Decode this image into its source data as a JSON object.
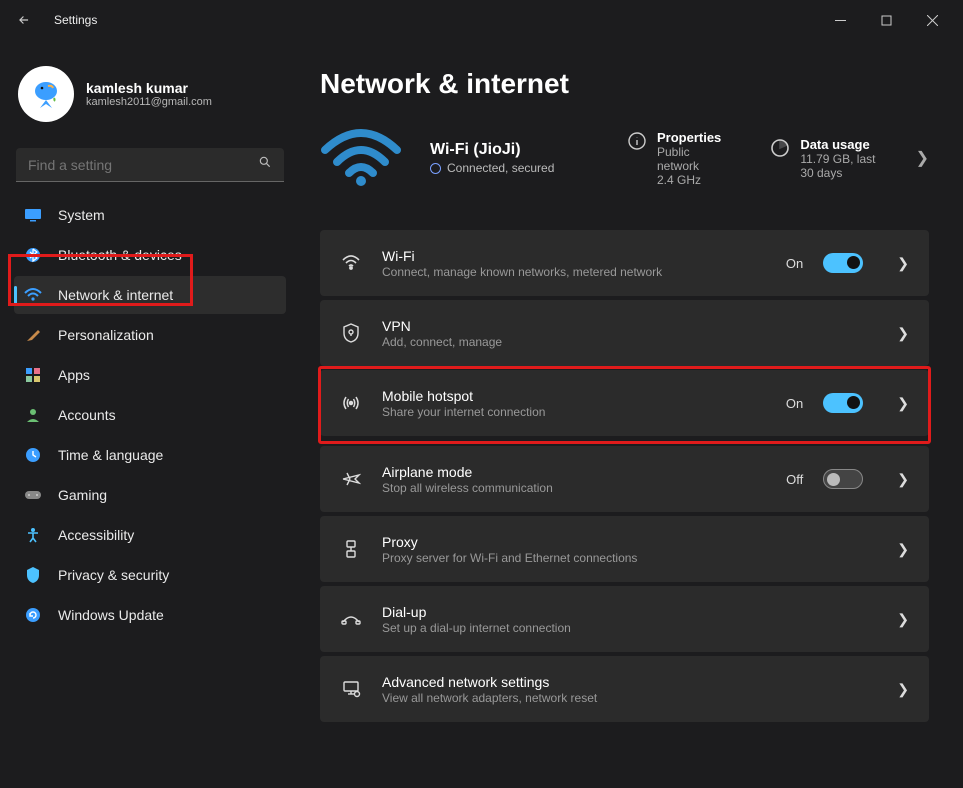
{
  "window": {
    "title": "Settings"
  },
  "user": {
    "name": "kamlesh kumar",
    "email": "kamlesh2011@gmail.com"
  },
  "search": {
    "placeholder": "Find a setting"
  },
  "nav": {
    "items": [
      {
        "label": "System"
      },
      {
        "label": "Bluetooth & devices"
      },
      {
        "label": "Network & internet"
      },
      {
        "label": "Personalization"
      },
      {
        "label": "Apps"
      },
      {
        "label": "Accounts"
      },
      {
        "label": "Time & language"
      },
      {
        "label": "Gaming"
      },
      {
        "label": "Accessibility"
      },
      {
        "label": "Privacy & security"
      },
      {
        "label": "Windows Update"
      }
    ]
  },
  "page": {
    "title": "Network & internet",
    "wifi": {
      "name": "Wi-Fi (JioJi)",
      "status": "Connected, secured"
    },
    "properties": {
      "head": "Properties",
      "line1": "Public network",
      "line2": "2.4 GHz"
    },
    "usage": {
      "head": "Data usage",
      "line1": "11.79 GB, last 30 days"
    }
  },
  "cards": {
    "wifi": {
      "title": "Wi-Fi",
      "sub": "Connect, manage known networks, metered network",
      "state": "On"
    },
    "vpn": {
      "title": "VPN",
      "sub": "Add, connect, manage"
    },
    "hotspot": {
      "title": "Mobile hotspot",
      "sub": "Share your internet connection",
      "state": "On"
    },
    "airplane": {
      "title": "Airplane mode",
      "sub": "Stop all wireless communication",
      "state": "Off"
    },
    "proxy": {
      "title": "Proxy",
      "sub": "Proxy server for Wi-Fi and Ethernet connections"
    },
    "dialup": {
      "title": "Dial-up",
      "sub": "Set up a dial-up internet connection"
    },
    "advanced": {
      "title": "Advanced network settings",
      "sub": "View all network adapters, network reset"
    }
  }
}
